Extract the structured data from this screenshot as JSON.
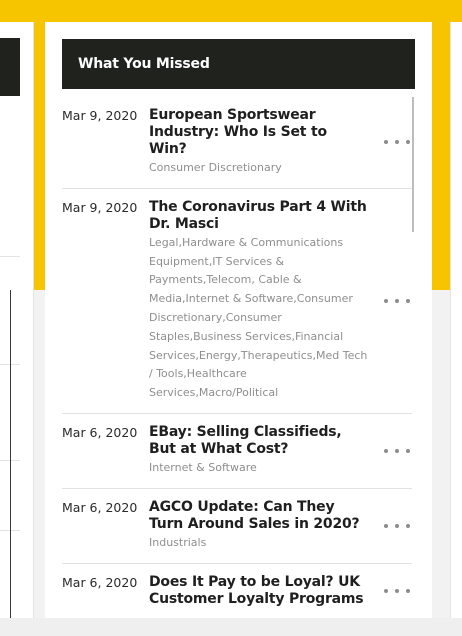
{
  "widget": {
    "title": "What You Missed",
    "items": [
      {
        "date": "Mar 9, 2020",
        "title": "European Sportswear Industry: Who Is Set to Win?",
        "category": "Consumer Discretionary",
        "menu_icon": "more-horizontal-icon"
      },
      {
        "date": "Mar 9, 2020",
        "title": "The Coronavirus Part 4 With Dr. Masci",
        "category": "Legal,Hardware & Communications Equipment,IT Services & Payments,Telecom, Cable & Media,Internet & Software,Consumer Discretionary,Consumer Staples,Business Services,Financial Services,Energy,Therapeutics,Med Tech / Tools,Healthcare Services,Macro/Political",
        "menu_icon": "more-horizontal-icon"
      },
      {
        "date": "Mar 6, 2020",
        "title": "EBay: Selling Classifieds, But at What Cost?",
        "category": "Internet & Software",
        "menu_icon": "more-horizontal-icon"
      },
      {
        "date": "Mar 6, 2020",
        "title": "AGCO Update: Can They Turn Around Sales in 2020?",
        "category": "Industrials",
        "menu_icon": "more-horizontal-icon"
      },
      {
        "date": "Mar 6, 2020",
        "title": "Does It Pay to be Loyal? UK Customer Loyalty Programs",
        "category": "",
        "menu_icon": "more-horizontal-icon"
      }
    ]
  },
  "colors": {
    "accent_yellow": "#f6c500",
    "header_bg": "#20221d",
    "category_text": "#8e8e8e"
  }
}
